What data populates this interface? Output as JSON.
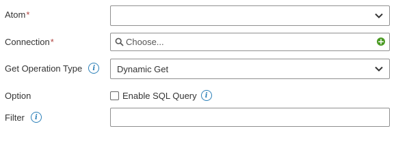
{
  "form": {
    "atom": {
      "label": "Atom",
      "required_mark": "*",
      "value": ""
    },
    "connection": {
      "label": "Connection",
      "required_mark": "*",
      "placeholder": "Choose..."
    },
    "operation_type": {
      "label": "Get Operation Type",
      "value": "Dynamic Get"
    },
    "option": {
      "label": "Option",
      "checkbox_label": "Enable SQL Query",
      "checked": false
    },
    "filter": {
      "label": "Filter",
      "value": ""
    }
  },
  "icons": {
    "info": "info-icon",
    "chevron": "chevron-down-icon",
    "search": "search-icon",
    "add": "add-icon"
  },
  "colors": {
    "required": "#b0413e",
    "info": "#2a7fb8",
    "add": "#4a9a23",
    "border": "#8f8f8f"
  }
}
